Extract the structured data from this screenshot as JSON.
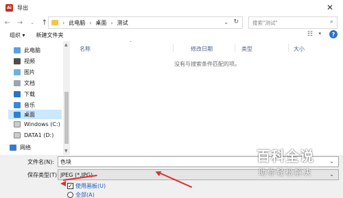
{
  "window": {
    "title": "导出",
    "app_icon": "adobe-app-icon"
  },
  "nav": {
    "crumbs": [
      "此电脑",
      "桌面",
      "测试"
    ],
    "search_placeholder": "搜索\"测试\""
  },
  "toolbar": {
    "organize": "组织 ▾",
    "new_folder": "新建文件夹"
  },
  "sidebar": {
    "items": [
      {
        "label": "此电脑",
        "icon": "computer-icon"
      },
      {
        "label": "视频",
        "icon": "video-icon"
      },
      {
        "label": "图片",
        "icon": "pictures-icon"
      },
      {
        "label": "文档",
        "icon": "documents-icon"
      },
      {
        "label": "下载",
        "icon": "download-icon"
      },
      {
        "label": "音乐",
        "icon": "music-icon"
      },
      {
        "label": "桌面",
        "icon": "desktop-icon",
        "active": true
      },
      {
        "label": "Windows (C:)",
        "icon": "drive-icon"
      },
      {
        "label": "DATA1 (D:)",
        "icon": "drive-icon"
      },
      {
        "label": "网络",
        "icon": "network-icon"
      }
    ]
  },
  "filelist": {
    "columns": [
      "名称",
      "修改日期",
      "类型",
      "大小"
    ],
    "empty_message": "没有与搜索条件匹配的项。"
  },
  "form": {
    "filename_label": "文件名(N):",
    "filename_value": "色块",
    "type_label": "保存类型(T):",
    "type_value": "JPEG (*.JPG)",
    "use_artboards": "使用画板(U)",
    "all_label": "全部(A)"
  },
  "watermark": {
    "main": "百科全说",
    "sub": "助你轻松解决"
  },
  "colors": {
    "accent": "#1b5bc0",
    "annotation": "#e03030",
    "selection": "#cce8ff"
  }
}
